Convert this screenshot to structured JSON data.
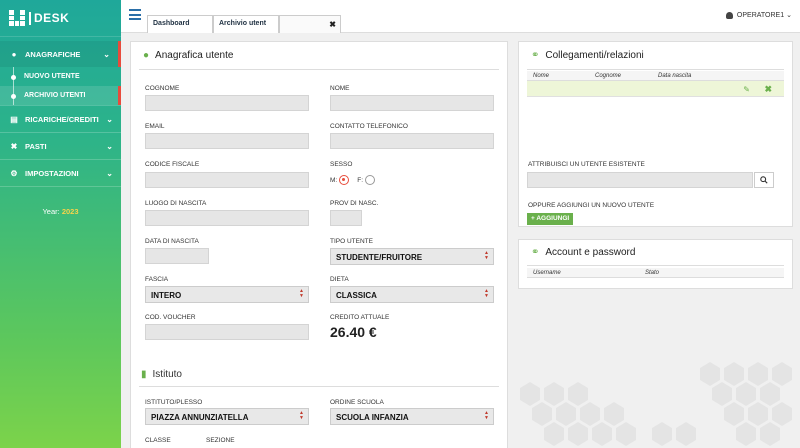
{
  "brand": {
    "name": "DESK"
  },
  "sidebar": {
    "items": [
      {
        "label": "ANAGRAFICHE",
        "icon": "user-icon"
      },
      {
        "label": "RICARICHE/CREDITI",
        "icon": "card-icon"
      },
      {
        "label": "PASTI",
        "icon": "cutlery-icon"
      },
      {
        "label": "IMPOSTAZIONI",
        "icon": "gears-icon"
      }
    ],
    "sub_items": [
      "NUOVO UTENTE",
      "ARCHIVIO UTENTI"
    ],
    "year_label": "Year:",
    "year_value": "2023"
  },
  "topbar": {
    "tabs": [
      "Dashboard",
      "Archivio utent"
    ],
    "user": "OPERATORE1"
  },
  "anagrafica": {
    "title": "Anagrafica utente",
    "fields": {
      "cognome": "COGNOME",
      "nome": "NOME",
      "email": "EMAIL",
      "contatto": "CONTATTO TELEFONICO",
      "codice_fiscale": "CODICE FISCALE",
      "sesso": "SESSO",
      "sesso_m": "M:",
      "sesso_f": "F:",
      "luogo_nascita": "LUOGO DI NASCITA",
      "prov_nasc": "PROV DI NASC.",
      "data_nascita": "DATA DI NASCITA",
      "tipo_utente": "TIPO UTENTE",
      "fascia": "FASCIA",
      "dieta": "DIETA",
      "voucher": "COD. VOUCHER",
      "credito": "CREDITO ATTUALE"
    },
    "values": {
      "tipo_utente": "STUDENTE/FRUITORE",
      "fascia": "INTERO",
      "dieta": "CLASSICA",
      "credito": "26.40 €"
    }
  },
  "istituto": {
    "title": "Istituto",
    "fields": {
      "plesso": "ISTITUTO/PLESSO",
      "ordine": "ORDINE SCUOLA",
      "classe": "CLASSE",
      "sezione": "SEZIONE"
    },
    "values": {
      "plesso": "PIAZZA ANNUNZIATELLA",
      "ordine": "SCUOLA INFANZIA"
    }
  },
  "collegamenti": {
    "title": "Collegamenti/relazioni",
    "columns": [
      "Nome",
      "Cognome",
      "Data nascita"
    ],
    "attribuisci_label": "ATTRIBUISCI UN UTENTE ESISTENTE",
    "oppure_label": "OPPURE AGGIUNGI UN NUOVO UTENTE",
    "add_button": "+ AGGIUNGI"
  },
  "account": {
    "title": "Account e password",
    "columns": [
      "Username",
      "Stato"
    ]
  }
}
